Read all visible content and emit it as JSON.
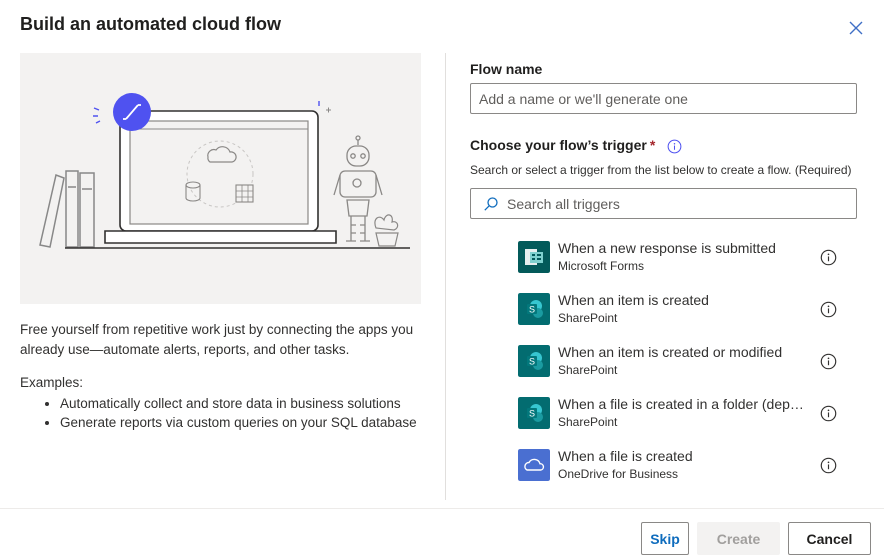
{
  "dialog": {
    "title": "Build an automated cloud flow",
    "description": "Free yourself from repetitive work just by connecting the apps you already use—automate alerts, reports, and other tasks.",
    "examples_label": "Examples:",
    "examples": [
      "Automatically collect and store data in business solutions",
      "Generate reports via custom queries on your SQL database"
    ]
  },
  "form": {
    "flow_name_label": "Flow name",
    "flow_name_placeholder": "Add a name or we'll generate one",
    "flow_name_value": "",
    "trigger_label": "Choose your flow’s trigger",
    "required_marker": "*",
    "trigger_helper": "Search or select a trigger from the list below to create a flow. (Required)",
    "search_placeholder": "Search all triggers"
  },
  "triggers": [
    {
      "name": "When a new response is submitted",
      "connector": "Microsoft Forms",
      "icon": "forms-icon",
      "color": "#035a5a"
    },
    {
      "name": "When an item is created",
      "connector": "SharePoint",
      "icon": "sharepoint-icon",
      "color": "#036c70"
    },
    {
      "name": "When an item is created or modified",
      "connector": "SharePoint",
      "icon": "sharepoint-icon",
      "color": "#036c70"
    },
    {
      "name": "When a file is created in a folder (deprecated)",
      "connector": "SharePoint",
      "icon": "sharepoint-icon",
      "color": "#036c70"
    },
    {
      "name": "When a file is created",
      "connector": "OneDrive for Business",
      "icon": "onedrive-icon",
      "color": "#4a6fd1"
    }
  ],
  "buttons": {
    "skip": "Skip",
    "create": "Create",
    "cancel": "Cancel"
  },
  "colors": {
    "accent": "#0f6cbd",
    "flow_badge": "#4f52f0",
    "required": "#a4262c"
  }
}
